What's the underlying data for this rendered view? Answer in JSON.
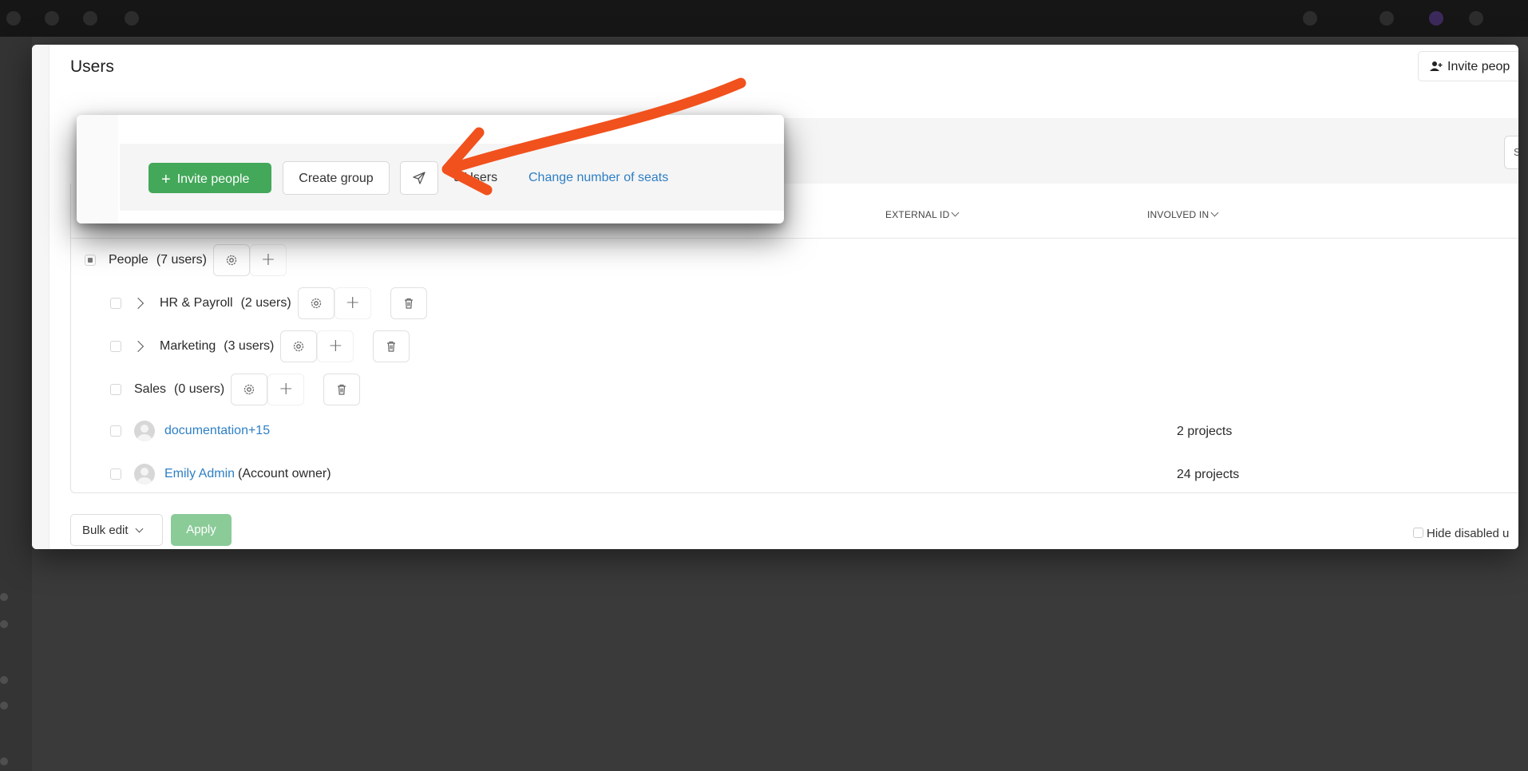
{
  "modal": {
    "title": "Users",
    "invite_top_label": "Invite peop"
  },
  "toolbar": {
    "invite_label": "Invite people",
    "create_group_label": "Create group",
    "users_count": "9 Users",
    "change_seats_label": "Change number of seats",
    "right_edge_label": "S"
  },
  "table": {
    "columns": [
      "EXTERNAL ID",
      "INVOLVED IN"
    ],
    "groups": [
      {
        "name": "People",
        "count": "(7 users)"
      },
      {
        "name": "HR & Payroll",
        "count": "(2 users)"
      },
      {
        "name": "Marketing",
        "count": "(3 users)"
      },
      {
        "name": "Sales",
        "count": "(0 users)"
      }
    ],
    "users": [
      {
        "name": "documentation+15",
        "note": "",
        "involved": "2 projects"
      },
      {
        "name": "Emily Admin",
        "note": "(Account owner)",
        "involved": "24 projects"
      }
    ]
  },
  "footer": {
    "bulk_edit_label": "Bulk edit",
    "apply_label": "Apply",
    "hide_disabled_label": "Hide disabled u"
  },
  "colors": {
    "primary_green": "#43a85a",
    "link_blue": "#2e7fc4",
    "annotation_arrow": "#f1511d"
  }
}
